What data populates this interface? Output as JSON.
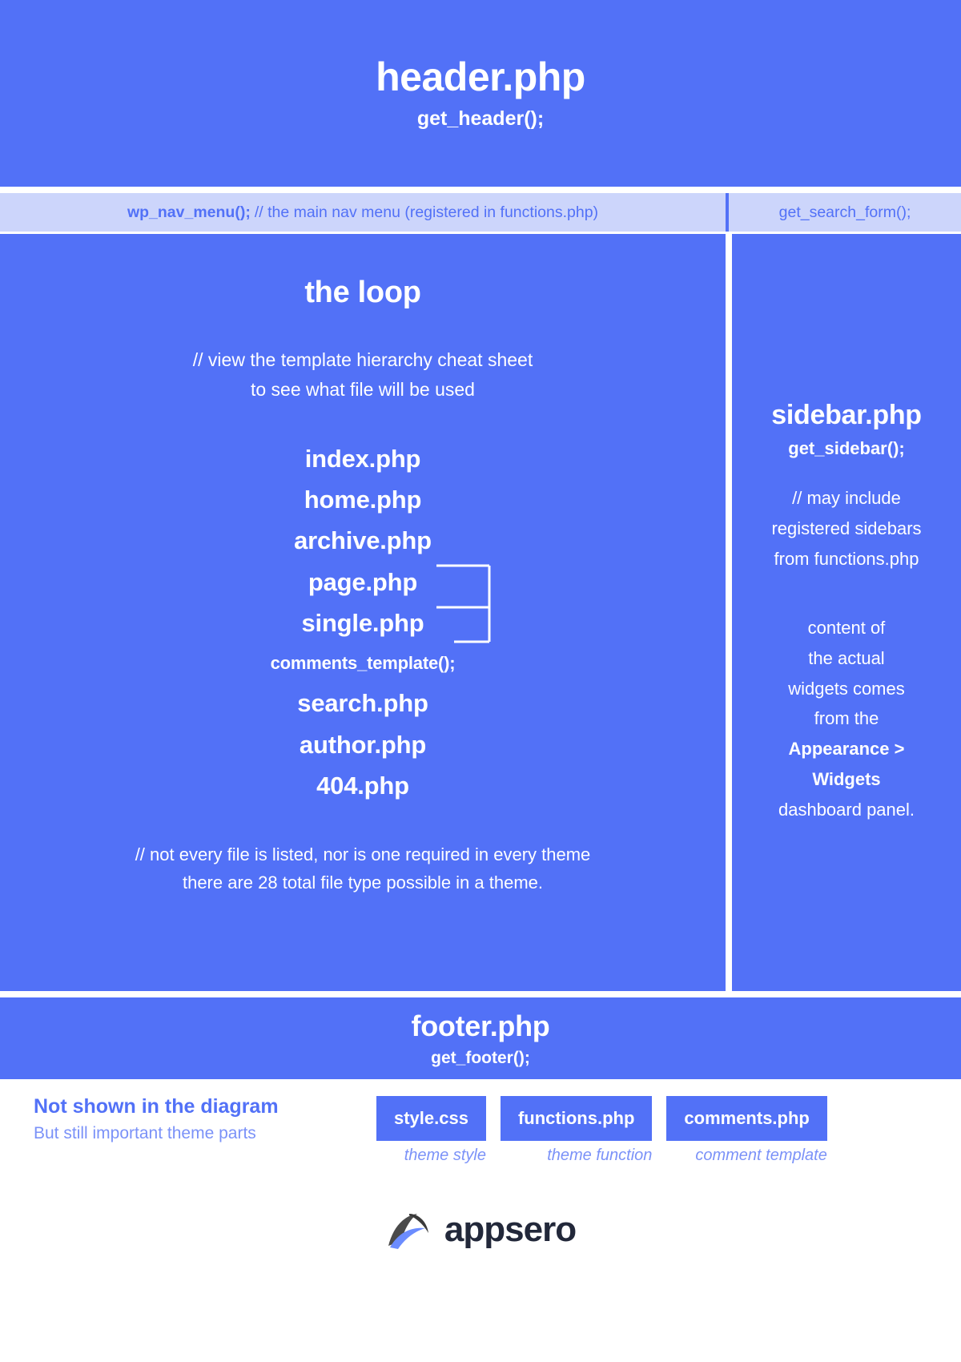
{
  "colors": {
    "primary_blue": "#5271f7",
    "nav_background": "#ccd5fb",
    "legend_caption": "#7b92f8",
    "brand_text": "#22283a",
    "page_background": "#ffffff"
  },
  "header": {
    "title": "header.php",
    "subtitle": "get_header();"
  },
  "nav": {
    "menu_function": "wp_nav_menu();",
    "menu_comment": "// the main nav menu (registered in functions.php)",
    "search_function": "get_search_form();"
  },
  "loop": {
    "title": "the loop",
    "note_line1": "// view the template hierarchy cheat sheet",
    "note_line2": "to see what file will be used",
    "files": [
      {
        "name": "index.php",
        "size": "large"
      },
      {
        "name": "home.php",
        "size": "large"
      },
      {
        "name": "archive.php",
        "size": "large"
      },
      {
        "name": "page.php",
        "size": "large"
      },
      {
        "name": "single.php",
        "size": "large"
      },
      {
        "name": "comments_template();",
        "size": "small"
      },
      {
        "name": "search.php",
        "size": "large"
      },
      {
        "name": "author.php",
        "size": "large"
      },
      {
        "name": "404.php",
        "size": "large"
      }
    ],
    "footnote_line1": "// not every file is listed, nor is one required in every theme",
    "footnote_line2": "there are 28 total file type possible in a theme."
  },
  "sidebar": {
    "title": "sidebar.php",
    "subtitle": "get_sidebar();",
    "note_line1": "// may include",
    "note_line2": "registered sidebars",
    "note_line3": "from functions.php",
    "note2_line1": "content of",
    "note2_line2": "the actual",
    "note2_line3": "widgets comes",
    "note2_line4": "from the",
    "note2_line5_bold": "Appearance >",
    "note2_line6_bold": "Widgets",
    "note2_line7": "dashboard panel."
  },
  "footer": {
    "title": "footer.php",
    "subtitle": "get_footer();"
  },
  "legend": {
    "title": "Not shown in the diagram",
    "subtitle": "But still important theme parts",
    "badges": [
      {
        "label": "style.css",
        "caption": "theme style"
      },
      {
        "label": "functions.php",
        "caption": "theme function"
      },
      {
        "label": "comments.php",
        "caption": "comment template"
      }
    ]
  },
  "brand": {
    "name": "appsero",
    "logo": "appsero-swoosh-logo"
  }
}
